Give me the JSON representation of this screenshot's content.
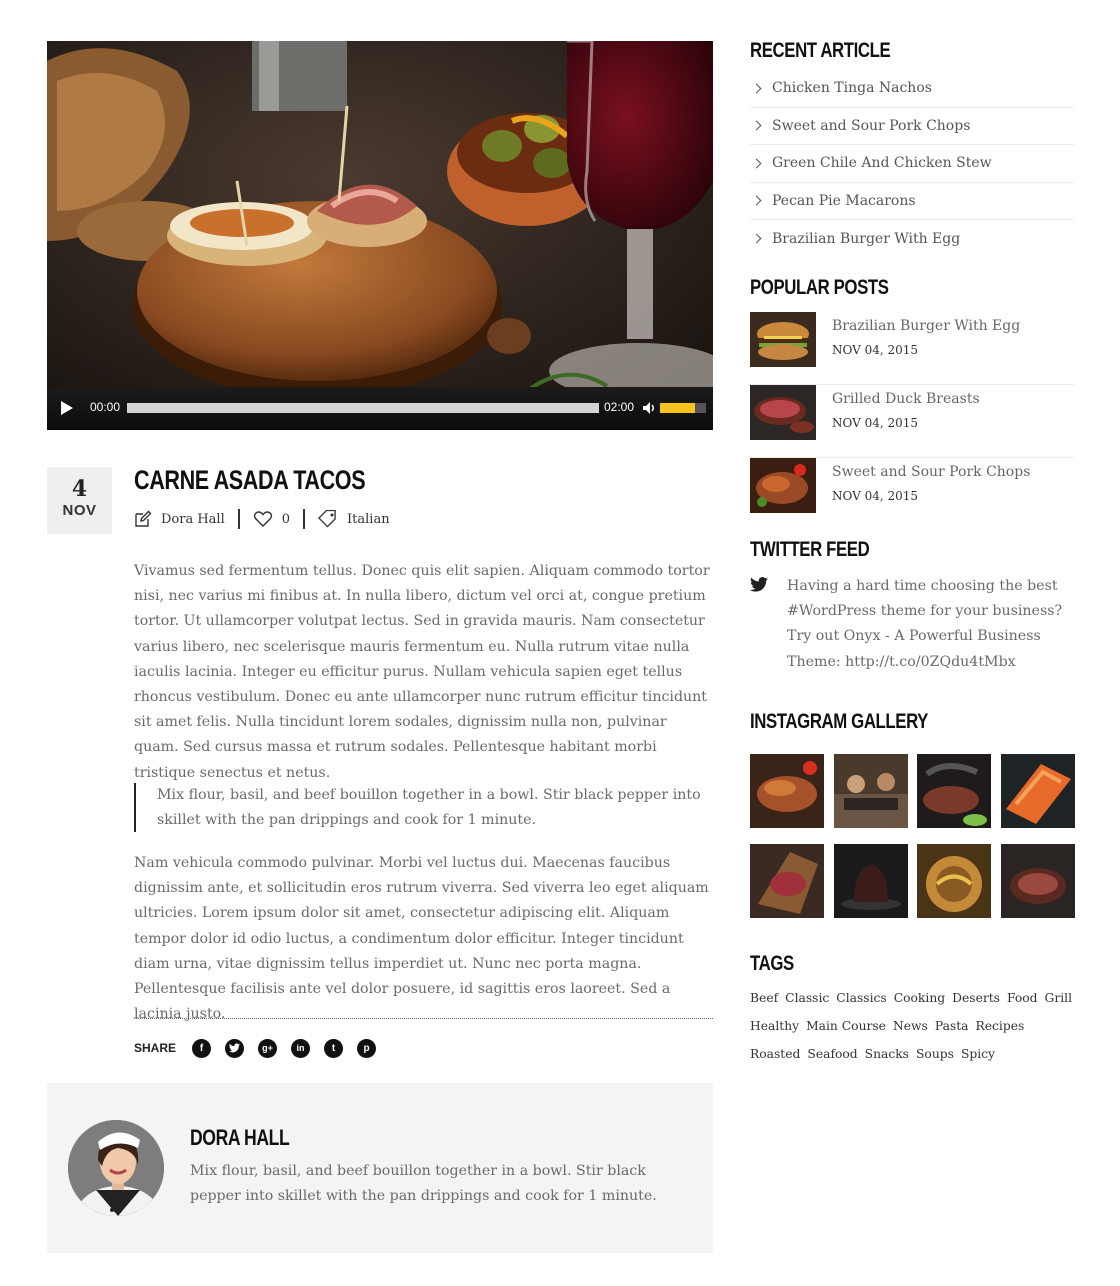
{
  "video": {
    "current_time": "00:00",
    "duration": "02:00",
    "progress": 0,
    "volume": 0.75
  },
  "post": {
    "date_day": "4",
    "date_month": "NOV",
    "title": "CARNE ASADA TACOS",
    "author": "Dora Hall",
    "likes": "0",
    "category": "Italian",
    "paragraph1": "Vivamus sed fermentum tellus. Donec quis elit sapien. Aliquam commodo tortor nisi, nec varius mi finibus at. In nulla libero, dictum vel orci at, congue pretium tortor. Ut ullamcorper volutpat lectus. Sed in gravida mauris. Nam consectetur varius libero, nec scelerisque mauris fermentum eu. Nulla rutrum vitae nulla iaculis lacinia. Integer eu efficitur purus. Nullam vehicula sapien eget tellus rhoncus vestibulum. Donec eu ante ullamcorper nunc rutrum efficitur tincidunt sit amet felis. Nulla tincidunt lorem sodales, dignissim nulla non, pulvinar quam. Sed cursus massa et rutrum sodales. Pellentesque habitant morbi tristique senectus et netus.",
    "quote": "Mix flour, basil, and beef bouillon together in a bowl. Stir black pepper into skillet with the pan drippings and cook for 1 minute.",
    "paragraph2": "Nam vehicula commodo pulvinar. Morbi vel luctus dui. Maecenas faucibus dignissim ante, et sollicitudin eros rutrum viverra. Sed viverra leo eget aliquam ultricies. Lorem ipsum dolor sit amet, consectetur adipiscing elit. Aliquam tempor dolor id odio luctus, a condimentum dolor efficitur. Integer tincidunt diam urna, vitae dignissim tellus imperdiet ut. Nunc nec porta magna. Pellentesque facilisis ante vel dolor posuere, id sagittis eros laoreet. Sed a lacinia justo."
  },
  "share": {
    "label": "SHARE",
    "icons": [
      "facebook-icon",
      "twitter-icon",
      "google-plus-icon",
      "linkedin-icon",
      "tumblr-icon",
      "pinterest-icon"
    ]
  },
  "author_box": {
    "name": "DORA HALL",
    "bio": "Mix flour, basil, and beef bouillon together in a bowl. Stir black pepper into skillet with the pan drippings and cook for 1 minute."
  },
  "sidebar": {
    "recent_heading": "RECENT ARTICLE",
    "recent": [
      "Chicken Tinga Nachos",
      "Sweet and Sour Pork Chops",
      "Green Chile And Chicken Stew",
      "Pecan Pie Macarons",
      "Brazilian Burger With Egg"
    ],
    "popular_heading": "POPULAR POSTS",
    "popular": [
      {
        "title": "Brazilian Burger With Egg",
        "date": "NOV 04, 2015"
      },
      {
        "title": "Grilled Duck Breasts",
        "date": "NOV 04, 2015"
      },
      {
        "title": "Sweet and Sour Pork Chops",
        "date": "NOV 04, 2015"
      }
    ],
    "twitter_heading": "TWITTER FEED",
    "tweet": "Having a hard time choosing the best #WordPress theme for your business? Try out Onyx - A Powerful Business Theme: http://t.co/0ZQdu4tMbx",
    "instagram_heading": "INSTAGRAM GALLERY",
    "tags_heading": "TAGS",
    "tags": [
      "Beef",
      "Classic",
      "Classics",
      "Cooking",
      "Deserts",
      "Food",
      "Grill",
      "Healthy",
      "Main Course",
      "News",
      "Pasta",
      "Recipes",
      "Roasted",
      "Seafood",
      "Snacks",
      "Soups",
      "Spicy"
    ]
  },
  "colors": {
    "accent_yellow": "#f6c31c",
    "heading": "#111111",
    "body_text": "#6a6a6a",
    "panel_bg": "#f4f4f4"
  }
}
